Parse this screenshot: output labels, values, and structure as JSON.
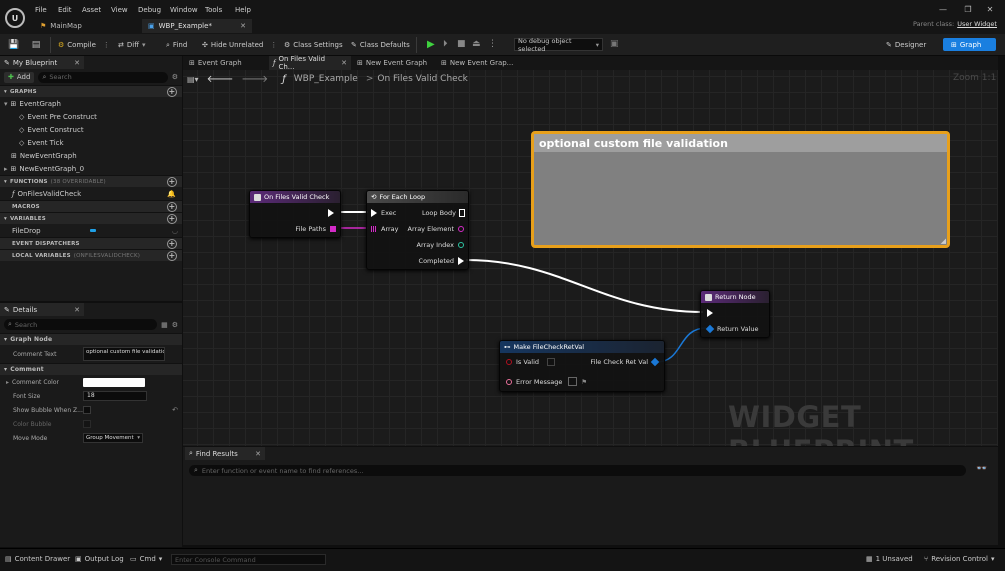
{
  "menu": [
    "File",
    "Edit",
    "Asset",
    "View",
    "Debug",
    "Window",
    "Tools",
    "Help"
  ],
  "doc_tabs": [
    {
      "label": "MainMap"
    },
    {
      "label": "WBP_Example*"
    }
  ],
  "parent_class": {
    "label": "Parent class:",
    "value": "User Widget"
  },
  "toolbar": {
    "compile": "Compile",
    "diff": "Diff",
    "find": "Find",
    "hide_unrelated": "Hide Unrelated",
    "class_settings": "Class Settings",
    "class_defaults": "Class Defaults",
    "debug_object": "No debug object selected",
    "designer": "Designer",
    "graph": "Graph"
  },
  "my_blueprint": {
    "tab": "My Blueprint",
    "add": "Add",
    "search_placeholder": "Search",
    "graphs_header": "GRAPHS",
    "event_graph": "EventGraph",
    "events": [
      "Event Pre Construct",
      "Event Construct",
      "Event Tick"
    ],
    "graphs_extra": [
      "NewEventGraph",
      "NewEventGraph_0"
    ],
    "functions_header": "FUNCTIONS",
    "functions_overridable": "(38 OVERRIDABLE)",
    "function_item": "OnFilesValidCheck",
    "macros_header": "MACROS",
    "variables_header": "VARIABLES",
    "variable_item": "FileDrop",
    "dispatchers_header": "EVENT DISPATCHERS",
    "local_vars_header": "LOCAL VARIABLES",
    "local_vars_scope": "(ONFILESVALIDCHECK)"
  },
  "details": {
    "tab": "Details",
    "search_placeholder": "Search",
    "graph_node_header": "Graph Node",
    "comment_text_label": "Comment Text",
    "comment_text_value": "optional custom file validation",
    "comment_header": "Comment",
    "comment_color_label": "Comment Color",
    "font_size_label": "Font Size",
    "font_size_value": "18",
    "show_bubble_label": "Show Bubble When Z...",
    "color_bubble_label": "Color Bubble",
    "move_mode_label": "Move Mode",
    "move_mode_value": "Group Movement"
  },
  "graph_tabs": [
    "Event Graph",
    "On Files Valid Ch...",
    "New Event Graph",
    "New Event Grap..."
  ],
  "breadcrumb": {
    "root": "WBP_Example",
    "sep": ">",
    "leaf": "On Files Valid Check"
  },
  "zoom": "Zoom 1:1",
  "watermark": "WIDGET BLUEPRINT",
  "comment_box": {
    "title": "optional custom file validation",
    "color": "#e8a01b"
  },
  "nodes": {
    "on_files_valid_check": {
      "title": "On Files Valid Check",
      "pin_out": "File Paths"
    },
    "for_each_loop": {
      "title": "For Each Loop",
      "exec": "Exec",
      "array": "Array",
      "loop_body": "Loop Body",
      "array_element": "Array Element",
      "array_index": "Array Index",
      "completed": "Completed"
    },
    "return_node": {
      "title": "Return Node",
      "return_value": "Return Value"
    },
    "make_struct": {
      "title": "Make FileCheckRetVal",
      "is_valid": "Is Valid",
      "error_message": "Error Message",
      "out": "File Check Ret Val"
    }
  },
  "find_results": {
    "tab": "Find Results",
    "placeholder": "Enter function or event name to find references..."
  },
  "status": {
    "content_drawer": "Content Drawer",
    "output_log": "Output Log",
    "cmd": "Cmd",
    "console_placeholder": "Enter Console Command",
    "unsaved": "1 Unsaved",
    "revision": "Revision Control"
  },
  "colors": {
    "accent": "#1a7fe0",
    "function_header": "#5b2a78",
    "loop_header": "#3c3c3c",
    "struct_header": "#16365f",
    "struct_pin": "#1a78d6",
    "array_pin": "#d42bc8",
    "int_pin": "#2ec6a4"
  }
}
